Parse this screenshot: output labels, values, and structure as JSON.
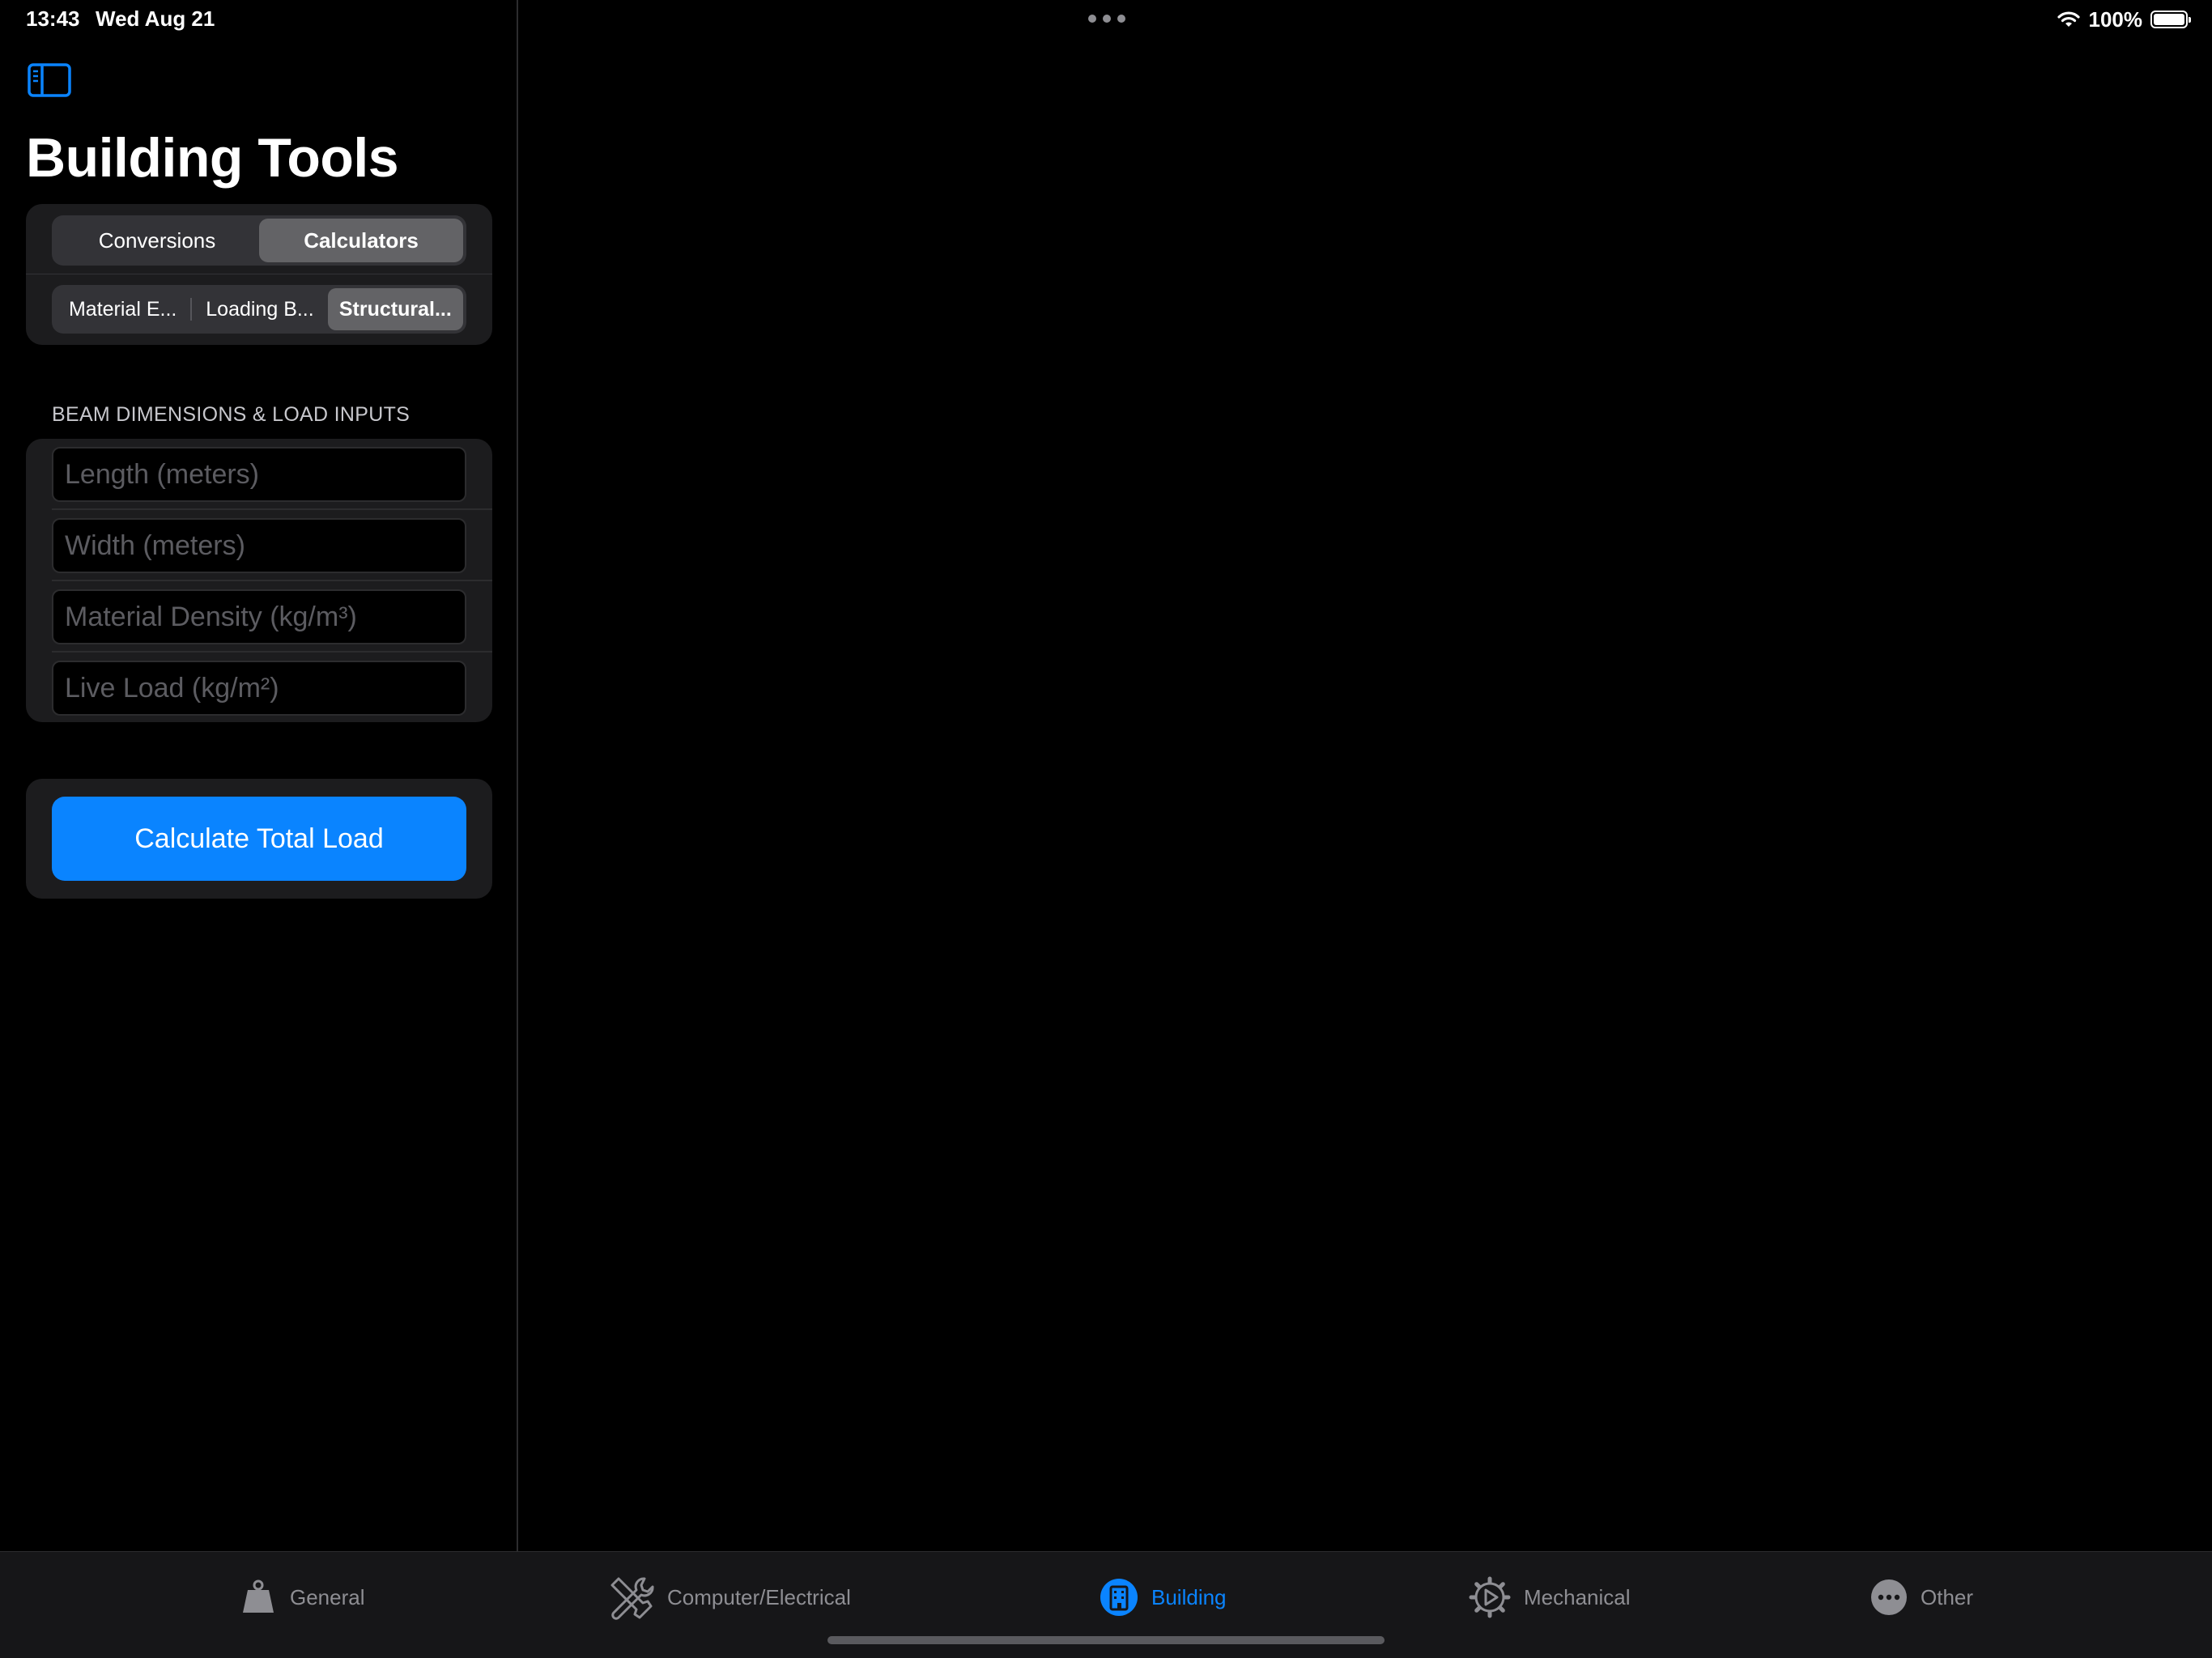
{
  "status_bar": {
    "time": "13:43",
    "date": "Wed Aug 21",
    "battery": "100%",
    "battery_level": 1.0
  },
  "sidebar": {
    "toggle_icon": "sidebar-left-icon",
    "title": "Building Tools",
    "main_segments": [
      {
        "label": "Conversions",
        "selected": false
      },
      {
        "label": "Calculators",
        "selected": true
      }
    ],
    "sub_segments": [
      {
        "label": "Material E...",
        "selected": false
      },
      {
        "label": "Loading B...",
        "selected": false
      },
      {
        "label": "Structural...",
        "selected": true
      }
    ],
    "section_header": "BEAM DIMENSIONS & LOAD INPUTS",
    "inputs": [
      {
        "placeholder": "Length (meters)",
        "value": ""
      },
      {
        "placeholder": "Width (meters)",
        "value": ""
      },
      {
        "placeholder": "Material Density (kg/m³)",
        "value": ""
      },
      {
        "placeholder": "Live Load (kg/m²)",
        "value": ""
      }
    ],
    "action_button": "Calculate Total Load"
  },
  "tab_bar": {
    "tabs": [
      {
        "label": "General",
        "icon": "weight-icon",
        "active": false
      },
      {
        "label": "Computer/Electrical",
        "icon": "tools-icon",
        "active": false
      },
      {
        "label": "Building",
        "icon": "building-icon",
        "active": true
      },
      {
        "label": "Mechanical",
        "icon": "gear-icon",
        "active": false
      },
      {
        "label": "Other",
        "icon": "ellipsis-circle-icon",
        "active": false
      }
    ]
  },
  "colors": {
    "accent": "#0a84ff",
    "background": "#000000",
    "card": "#1c1c1e",
    "inactive_tab": "#8e8e93"
  }
}
